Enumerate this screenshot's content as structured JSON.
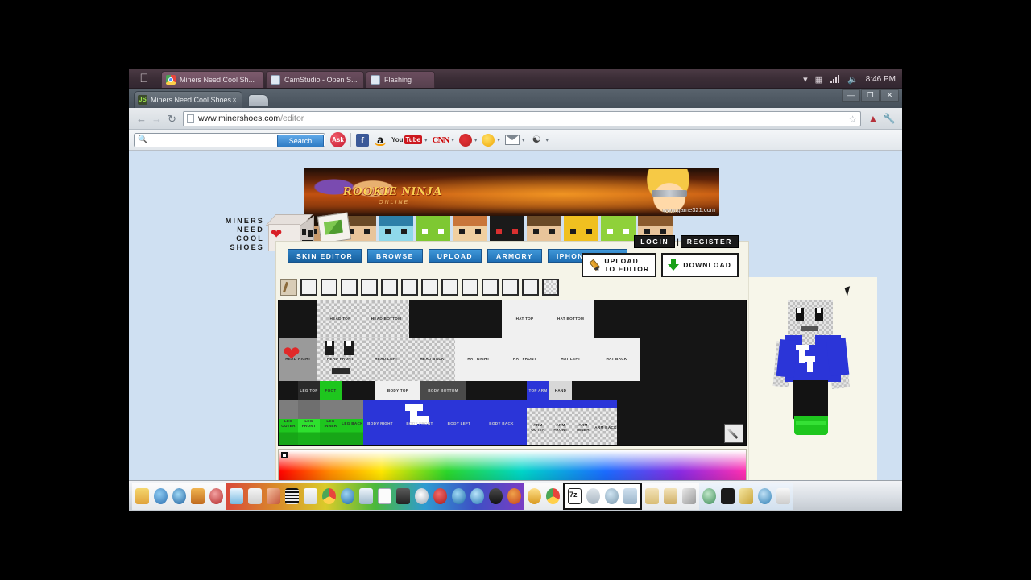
{
  "macbar": {
    "apple_icon": "apple-logo-icon",
    "tabs": [
      {
        "label": "Miners Need Cool Sh...",
        "icon": "chrome-icon",
        "active": true
      },
      {
        "label": "CamStudio - Open S...",
        "icon": "document-icon",
        "active": false
      },
      {
        "label": "Flashing",
        "icon": "document-icon",
        "active": false
      }
    ],
    "tray": {
      "chevron": "chevron-down-icon",
      "screen_icon": "display-icon",
      "signal_icon": "signal-bars-icon",
      "volume_icon": "volume-icon",
      "clock": "8:46 PM"
    }
  },
  "browser": {
    "tab": {
      "title": "Miners Need Cool Shoes |",
      "favicon": "js-favicon",
      "close": "×"
    },
    "new_tab_label": "",
    "window_controls": {
      "minimize": "—",
      "maximize": "❐",
      "close": "✕"
    },
    "toolbar": {
      "back": "←",
      "forward": "→",
      "reload": "↻",
      "url_main": "www.minershoes.com",
      "url_path": "/editor",
      "page_icon": "page-icon",
      "bookmark_star": "☆",
      "extension_icon": "extension-icon",
      "wrench_menu": "⚒"
    }
  },
  "ask_toolbar": {
    "search_placeholder": "",
    "search_value": "",
    "search_button": "Search",
    "ask_logo": "Ask",
    "links": [
      {
        "name": "facebook",
        "label": "f",
        "caret": false
      },
      {
        "name": "amazon",
        "label": "a",
        "caret": false
      },
      {
        "name": "youtube",
        "label": "You",
        "badge": "Tube",
        "caret": true
      },
      {
        "name": "cnn",
        "label": "CNN",
        "caret": true
      },
      {
        "name": "ebay",
        "label": "",
        "caret": true
      },
      {
        "name": "weather",
        "label": "",
        "caret": true
      },
      {
        "name": "mail",
        "label": "",
        "caret": true
      },
      {
        "name": "more",
        "label": "",
        "caret": true
      }
    ]
  },
  "ad_banner": {
    "title": "ROOKIE NINJA",
    "subtitle": "ONLINE",
    "url": "www.game321.com"
  },
  "site": {
    "logo_lines": [
      "MINERS",
      "NEED",
      "COOL",
      "SHOES"
    ],
    "nav": [
      {
        "label": "SKIN EDITOR",
        "selected": true
      },
      {
        "label": "BROWSE",
        "selected": false
      },
      {
        "label": "UPLOAD",
        "selected": false
      },
      {
        "label": "ARMORY",
        "selected": false
      },
      {
        "label": "IPHONE / IPAD",
        "selected": false
      }
    ],
    "auth": {
      "login": "LOGIN",
      "separator": "|",
      "register": "REGISTER"
    },
    "actions": [
      {
        "name": "upload-to-editor",
        "line1": "UPLOAD",
        "line2": "TO EDITOR",
        "icon": "pencil-icon"
      },
      {
        "name": "download",
        "line1": "DOWNLOAD",
        "line2": "",
        "icon": "download-arrow-icon"
      }
    ],
    "palette": {
      "brush_icon": "brush-icon",
      "swatch_count": 13,
      "swatches": [
        "#f2f2f2",
        "#f2f2f2",
        "#f2f2f2",
        "#f2f2f2",
        "#f2f2f2",
        "#f2f2f2",
        "#f2f2f2",
        "#f2f2f2",
        "#f2f2f2",
        "#f2f2f2",
        "#f2f2f2",
        "#f2f2f2",
        "transparent"
      ]
    },
    "texture_labels_row1": [
      "HEAD TOP",
      "HEAD BOTTOM",
      "HAT TOP",
      "HAT BOTTOM"
    ],
    "texture_labels_row2": [
      "HEAD RIGHT",
      "HEAD FRONT",
      "HEAD LEFT",
      "HEAD BACK",
      "HAT RIGHT",
      "HAT FRONT",
      "HAT LEFT",
      "HAT BACK"
    ],
    "texture_labels_row3": [
      "LEG TOP",
      "FOOT",
      "BODY TOP",
      "BODY BOTTOM",
      "TOP ARM",
      "HAND"
    ],
    "texture_labels_row4": [
      "LEG OUTER",
      "LEG FRONT",
      "LEG INNER",
      "LEG BACK",
      "BODY RIGHT",
      "BODY FRONT",
      "BODY LEFT",
      "BODY BACK",
      "ARM OUTER",
      "ARM FRONT",
      "ARM INNER",
      "ARM BACK"
    ],
    "eyedropper_icon": "eyedropper-icon",
    "color_picker": {
      "marker_position": "top-left",
      "type": "hue-saturation-gradient"
    },
    "preview": {
      "character_name": "skin-preview-3d",
      "shirt_color": "#2b35d8",
      "pants_color": "#1a1a1a",
      "shoes_color": "#1ec61e"
    }
  },
  "dock": {
    "icons": [
      "finder-icon",
      "itunes-icon",
      "firefox-icon",
      "winrar-icon",
      "media-player-icon",
      "paint-icon",
      "acrobat-icon",
      "photo-icon",
      "text-icon",
      "file-explorer-icon",
      "chrome-alt-icon",
      "ie-icon",
      "picture-viewer-icon",
      "document-icon",
      "camera-icon",
      "disc-icon",
      "camtasia-icon",
      "opera-icon",
      "ie-blue-icon",
      "steam-icon",
      "paint-net-icon",
      "sandbox-icon",
      "chrome-icon",
      "sevenzip-icon",
      "skype-icon",
      "network-icon",
      "folder-icon",
      "folder-docs-icon",
      "tools-icon",
      "globe-icon",
      "tshirt-icon",
      "wand-icon",
      "browser-icon",
      "app-icon"
    ]
  }
}
